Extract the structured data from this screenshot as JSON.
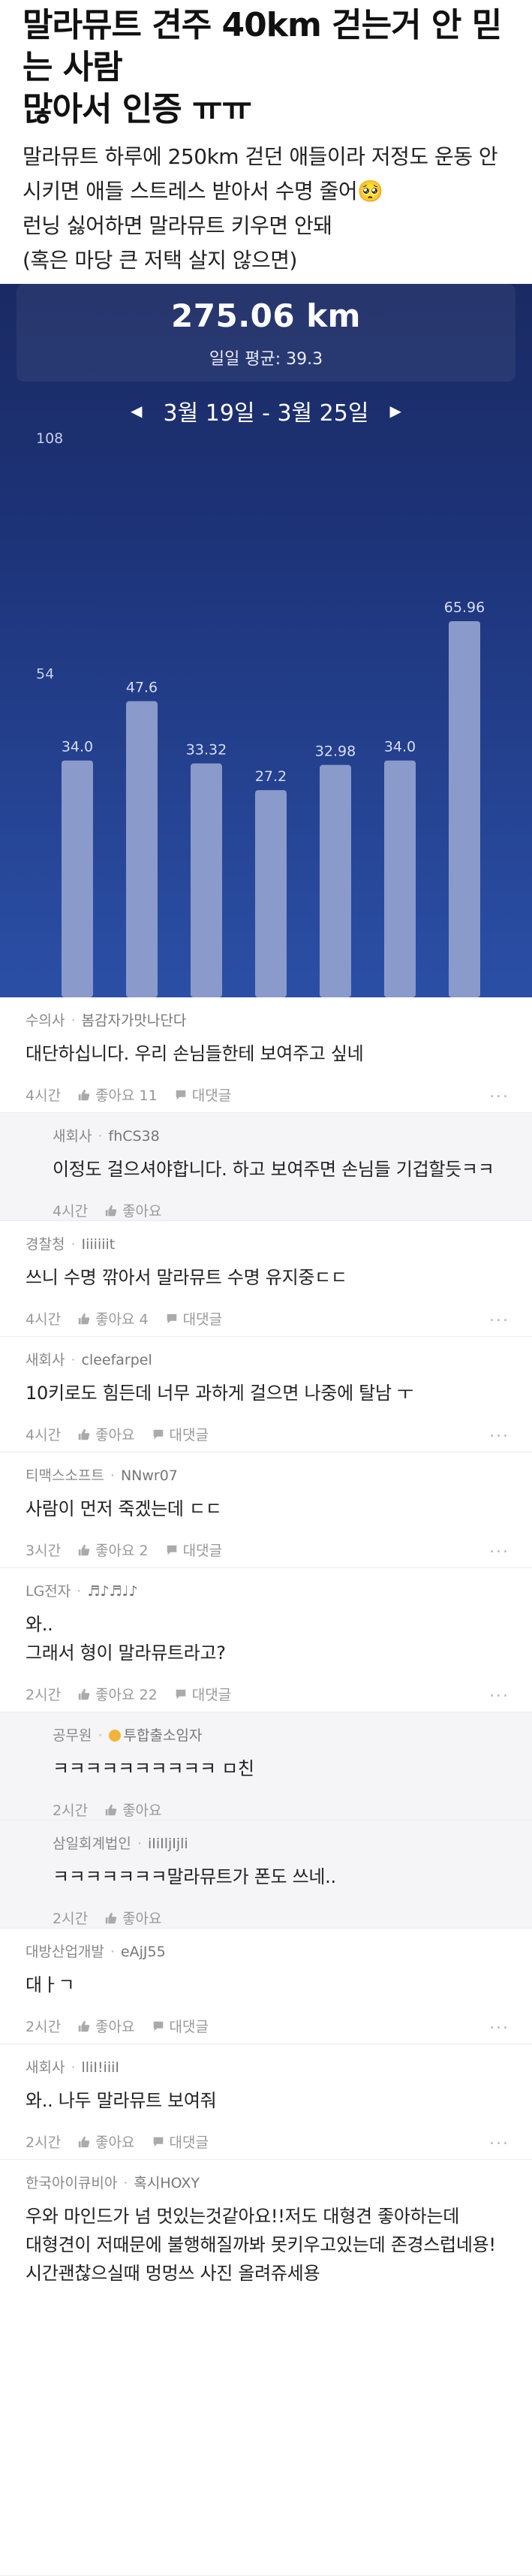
{
  "post": {
    "title_line1": "말라뮤트 견주 40km 걷는거 안 믿는 사람",
    "title_line2": "많아서 인증 ㅠㅠ",
    "body_lines": [
      "말라뮤트 하루에 250km 걷던 애들이라 저정도 운동 안",
      "시키면 애들 스트레스 받아서 수명 줄어🥺",
      "런닝 싫어하면 말라뮤트 키우면 안돼",
      "(혹은 마당 큰 저택 살지 않으면)"
    ]
  },
  "stats": {
    "total": "275.06 km",
    "daily_avg": "일일 평균:  39.3",
    "date_range": "3월 19일 - 3월 25일"
  },
  "chart_data": {
    "type": "bar",
    "categories": [
      "",
      "",
      "",
      "",
      "",
      "",
      ""
    ],
    "values": [
      34.0,
      47.6,
      33.32,
      27.2,
      32.98,
      34.0,
      65.96
    ],
    "value_labels": [
      "34.0",
      "47.6",
      "33.32",
      "27.2",
      "32.98",
      "34.0",
      "65.96"
    ],
    "y_ticks": [
      "108",
      "54"
    ],
    "ylim": [
      0,
      108
    ],
    "bar_color": "#8a9acb"
  },
  "comments": [
    {
      "company": "수의사",
      "nick": "봄감자가맛나단다",
      "text": [
        "대단하십니다. 우리 손님들한테 보여주고 싶네"
      ],
      "time": "4시간",
      "like": "좋아요 11",
      "reply": "대댓글",
      "is_reply": false,
      "more": "..."
    },
    {
      "company": "새회사",
      "nick": "fhCS38",
      "text": [
        "이정도 걸으셔야합니다. 하고 보여주면 손님들 기겁할듯ㅋㅋ"
      ],
      "time": "4시간",
      "like": "좋아요",
      "reply": "",
      "is_reply": true,
      "more": ""
    },
    {
      "company": "경찰청",
      "nick": "Iiiiiiit",
      "text": [
        "쓰니 수명 깎아서 말라뮤트 수명 유지중ㄷㄷ"
      ],
      "time": "4시간",
      "like": "좋아요 4",
      "reply": "대댓글",
      "is_reply": false,
      "more": "..."
    },
    {
      "company": "새회사",
      "nick": "cleefarpel",
      "text": [
        "10키로도 힘든데 너무 과하게 걸으면 나중에 탈남 ㅜ"
      ],
      "time": "4시간",
      "like": "좋아요",
      "reply": "대댓글",
      "is_reply": false,
      "more": "..."
    },
    {
      "company": "티맥스소프트",
      "nick": "NNwr07",
      "text": [
        "사람이 먼저 죽겠는데 ㄷㄷ"
      ],
      "time": "3시간",
      "like": "좋아요 2",
      "reply": "대댓글",
      "is_reply": false,
      "more": "..."
    },
    {
      "company": "LG전자",
      "nick": "♬♪♬♩♪",
      "text": [
        "와..",
        "그래서 형이 말라뮤트라고?"
      ],
      "time": "2시간",
      "like": "좋아요 22",
      "reply": "대댓글",
      "is_reply": false,
      "more": "..."
    },
    {
      "company": "공무원",
      "nick": "투합출소임자",
      "text": [
        "ㅋㅋㅋㅋㅋㅋㅋㅋㅋㅋ ㅁ친"
      ],
      "time": "2시간",
      "like": "좋아요",
      "reply": "",
      "is_reply": true,
      "more": "",
      "badge": true
    },
    {
      "company": "삼일회계법인",
      "nick": "iIiIljIjli",
      "text": [
        "ㅋㅋㅋㅋㅋㅋㅋ말라뮤트가 폰도 쓰네.."
      ],
      "time": "2시간",
      "like": "좋아요",
      "reply": "",
      "is_reply": true,
      "more": ""
    },
    {
      "company": "대방산업개발",
      "nick": "eAjJ55",
      "text": [
        "대ㅏㄱ"
      ],
      "time": "2시간",
      "like": "좋아요",
      "reply": "대댓글",
      "is_reply": false,
      "more": "..."
    },
    {
      "company": "새회사",
      "nick": "lliI!iiiI",
      "text": [
        "와.. 나두 말라뮤트 보여줘"
      ],
      "time": "2시간",
      "like": "좋아요",
      "reply": "대댓글",
      "is_reply": false,
      "more": "..."
    },
    {
      "company": "한국아이큐비아",
      "nick": "혹시HOXY",
      "text": [
        "우와 마인드가 넘 멋있는것같아요!!저도 대형견 좋아하는데",
        "대형견이 저때문에 불행해질까봐 못키우고있는데 존경스럽네용!",
        "시간괜찮으실때 멍멍쓰 사진 올려쥬세용"
      ],
      "time": "",
      "like": "",
      "reply": "",
      "is_reply": false,
      "more": ""
    }
  ]
}
